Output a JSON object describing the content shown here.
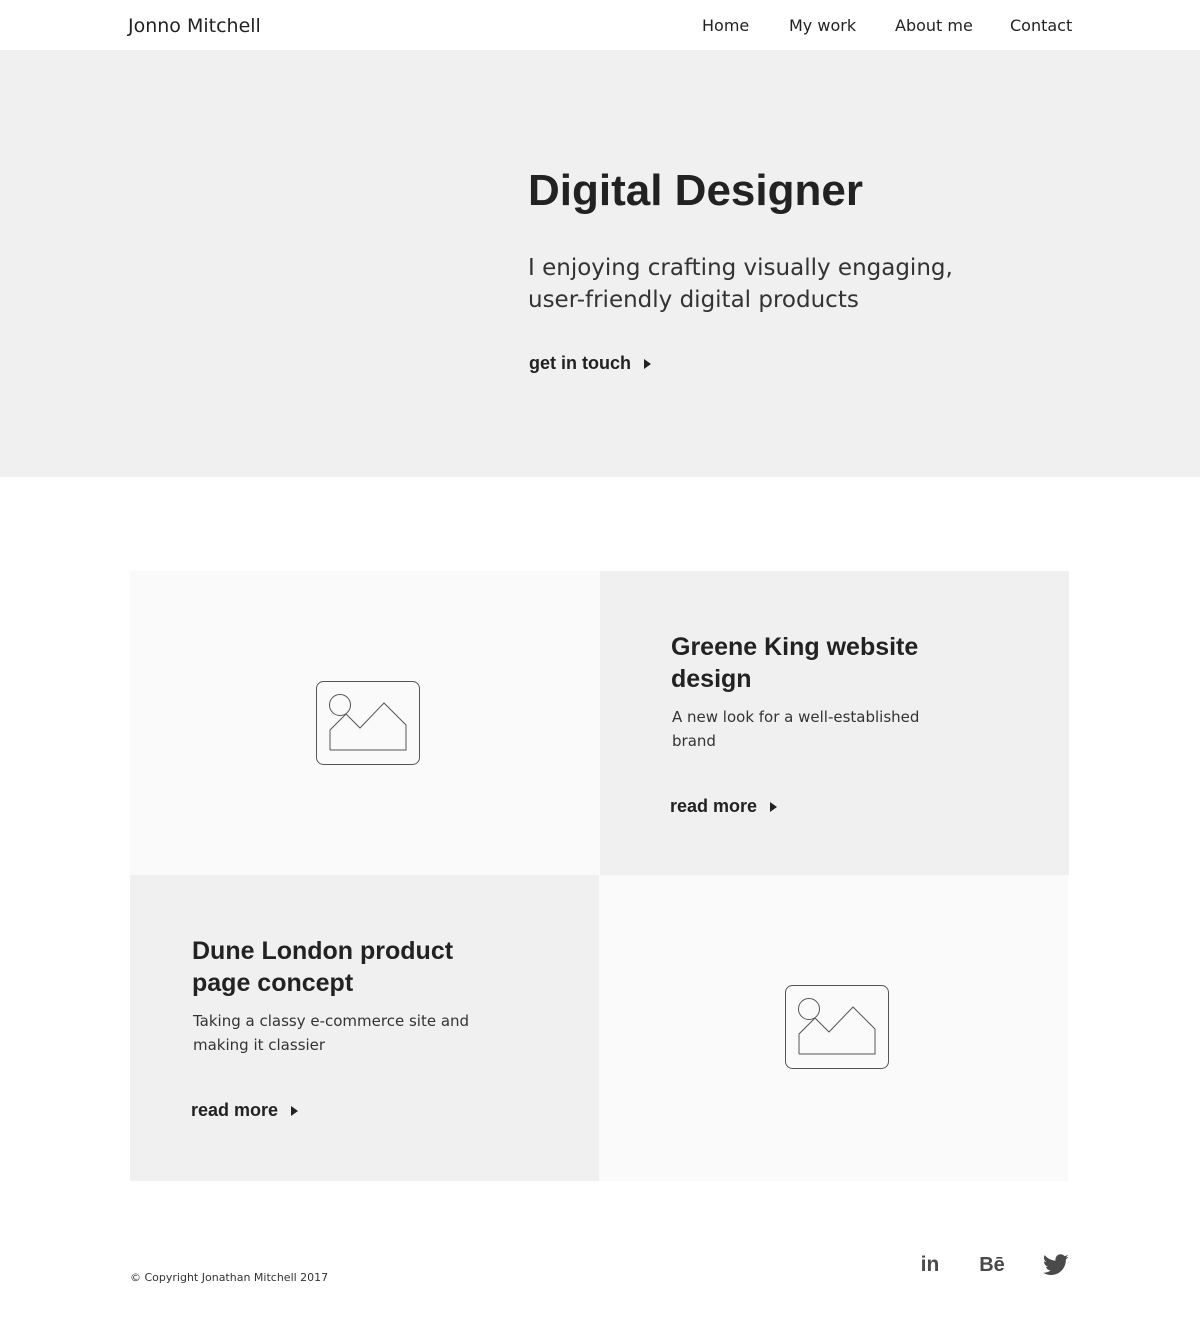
{
  "header": {
    "brand": "Jonno Mitchell",
    "nav": [
      "Home",
      "My work",
      "About me",
      "Contact"
    ]
  },
  "hero": {
    "title": "Digital Designer",
    "subtitle": "I enjoying crafting visually engaging, user-friendly digital products",
    "cta": "get in touch"
  },
  "projects": [
    {
      "title": "Greene King website design",
      "description": "A new look for a well-established brand",
      "link": "read more"
    },
    {
      "title": "Dune London product page concept",
      "description": "Taking a classy e-commerce site and making it classier",
      "link": "read more"
    }
  ],
  "footer": {
    "copyright": "© Copyright Jonathan Mitchell 2017",
    "social": [
      {
        "icon": "linkedin-icon",
        "glyph": "in"
      },
      {
        "icon": "behance-icon",
        "glyph": "Bē"
      },
      {
        "icon": "twitter-icon"
      }
    ]
  },
  "colors": {
    "text": "#222222",
    "hero_background": "#f0f0f0",
    "image_tile_background": "#fafafa",
    "icon": "#4a4a4a"
  }
}
